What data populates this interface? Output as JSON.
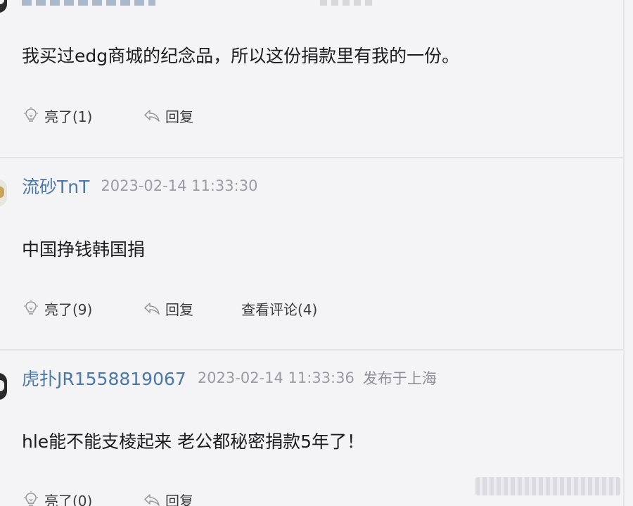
{
  "comments": [
    {
      "username": "",
      "timestamp": "",
      "location": "",
      "text": "我买过edg商城的纪念品，所以这份捐款里有我的一份。",
      "like_label": "亮了(1)",
      "reply_label": "回复",
      "view_label": ""
    },
    {
      "username": "流砂TnT",
      "timestamp": "2023-02-14 11:33:30",
      "location": "",
      "text": "中国挣钱韩国捐",
      "like_label": "亮了(9)",
      "reply_label": "回复",
      "view_label": "查看评论(4)"
    },
    {
      "username": "虎扑JR1558819067",
      "timestamp": "2023-02-14 11:33:36",
      "location": "发布于上海",
      "text": "hle能不能支棱起来 老公都秘密捐款5年了！",
      "like_label": "亮了(0)",
      "reply_label": "回复",
      "view_label": ""
    }
  ],
  "icons": {
    "like": "lightbulb-icon",
    "reply": "reply-arrow-icon"
  },
  "colors": {
    "background": "#f4f4f7",
    "username": "#4a78a8",
    "timestamp": "#9b9ba2",
    "text": "#1c1c1e",
    "action": "#3b3b3e",
    "divider": "#e2e2e6"
  }
}
